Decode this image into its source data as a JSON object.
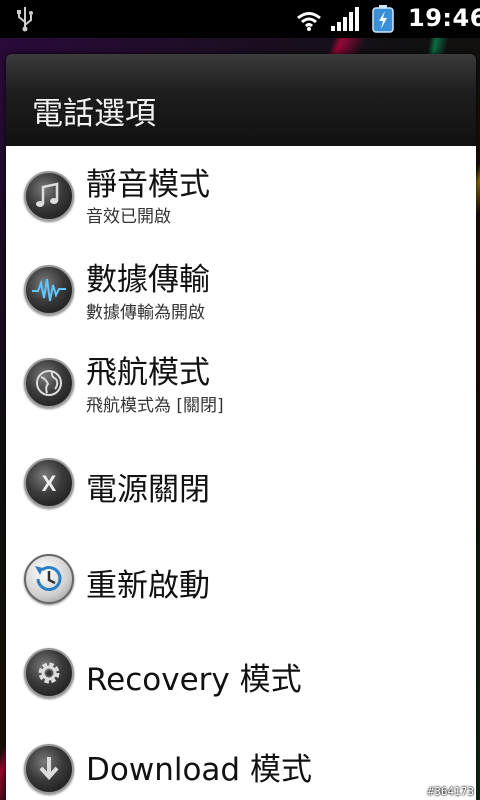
{
  "status_bar": {
    "time": "19:46",
    "icons": [
      "usb-icon",
      "wifi-icon",
      "signal-icon",
      "battery-charging-icon"
    ]
  },
  "dialog": {
    "title": "電話選項",
    "options": [
      {
        "label": "靜音模式",
        "subtitle": "音效已開啟",
        "icon": "music-note-icon"
      },
      {
        "label": "數據傳輸",
        "subtitle": "數據傳輸為開啟",
        "icon": "waveform-icon"
      },
      {
        "label": "飛航模式",
        "subtitle": "飛航模式為 [關閉]",
        "icon": "globe-icon"
      },
      {
        "label": "電源關閉",
        "icon": "x-icon"
      },
      {
        "label": "重新啟動",
        "icon": "restart-icon"
      },
      {
        "label": "Recovery 模式",
        "icon": "gear-icon"
      },
      {
        "label": "Download 模式",
        "icon": "download-icon"
      }
    ]
  },
  "watermark": "#364173"
}
